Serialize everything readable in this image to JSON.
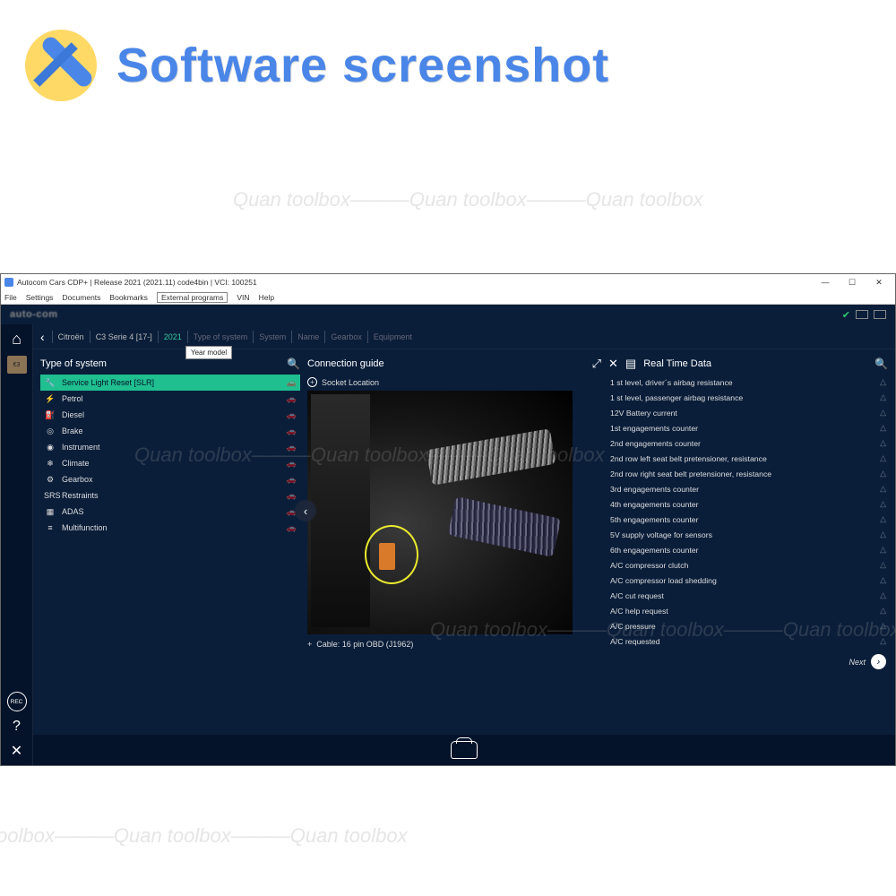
{
  "page_header": {
    "title": "Software screenshot"
  },
  "watermark": "Quan toolbox———Quan toolbox———Quan toolbox",
  "titlebar": {
    "text": "Autocom Cars CDP+ |  Release 2021 (2021.11) code4bin |  VCI: 100251"
  },
  "menubar": [
    "File",
    "Settings",
    "Documents",
    "Bookmarks",
    "External programs",
    "VIN",
    "Help"
  ],
  "brand": "auto-com",
  "breadcrumb": {
    "back": "‹",
    "items": [
      "Citroën",
      "C3 Serie 4 [17-]",
      "2021",
      "Type of system",
      "System",
      "Name",
      "Gearbox",
      "Equipment"
    ],
    "active_index": 2,
    "tooltip": "Year model"
  },
  "siderail": {
    "rec": "REC"
  },
  "panel_left": {
    "title": "Type of system",
    "items": [
      {
        "icon": "🔧",
        "label": "Service Light Reset [SLR]",
        "active": true
      },
      {
        "icon": "⚡",
        "label": "Petrol"
      },
      {
        "icon": "⛽",
        "label": "Diesel"
      },
      {
        "icon": "◎",
        "label": "Brake"
      },
      {
        "icon": "◉",
        "label": "Instrument"
      },
      {
        "icon": "❄",
        "label": "Climate"
      },
      {
        "icon": "⚙",
        "label": "Gearbox"
      },
      {
        "icon": "SRS",
        "label": "Restraints"
      },
      {
        "icon": "▦",
        "label": "ADAS"
      },
      {
        "icon": "≡",
        "label": "Multifunction"
      }
    ]
  },
  "panel_mid": {
    "title": "Connection guide",
    "socket": "Socket Location",
    "cable": "Cable: 16 pin OBD (J1962)"
  },
  "panel_right": {
    "title": "Real Time Data",
    "items": [
      "1 st level, driver´s airbag resistance",
      "1 st level, passenger airbag resistance",
      "12V Battery current",
      "1st engagements counter",
      "2nd engagements counter",
      "2nd row left seat belt pretensioner, resistance",
      "2nd row right seat belt pretensioner, resistance",
      "3rd engagements counter",
      "4th engagements counter",
      "5th engagements counter",
      "5V supply voltage for sensors",
      "6th engagements counter",
      "A/C compressor clutch",
      "A/C compressor load shedding",
      "A/C cut request",
      "A/C help request",
      "A/C pressure",
      "A/C requested"
    ],
    "next": "Next"
  }
}
